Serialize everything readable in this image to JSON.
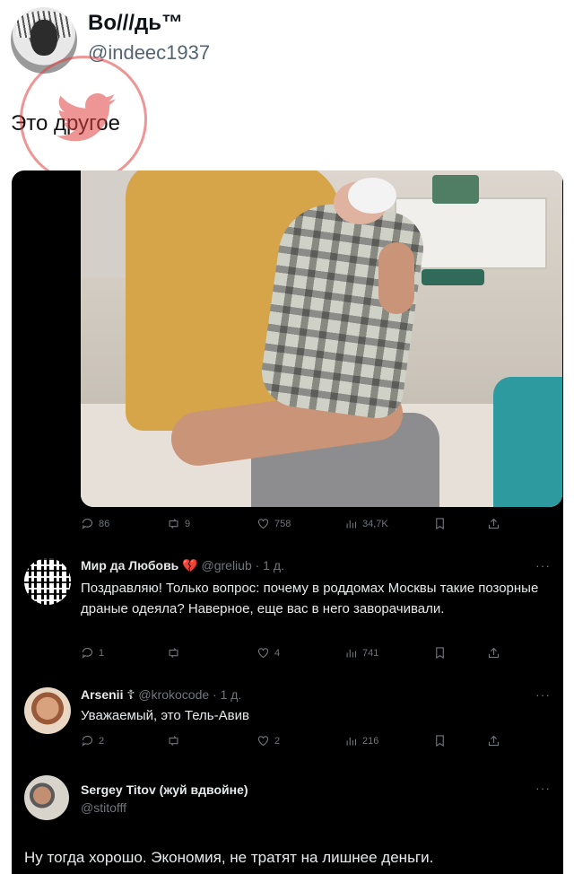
{
  "outer": {
    "name": "Во///дь™",
    "handle": "@indeec1937",
    "text": "Это другое"
  },
  "main_tweet_actions": {
    "replies": "86",
    "retweets": "9",
    "likes": "758",
    "views": "34,7K"
  },
  "replies": [
    {
      "name": "Мир да Любовь 💔",
      "handle_time": "@greliub · 1 д.",
      "text": "Поздравляю! Только вопрос: почему в роддомах Москвы такие позорные драные одеяла? Наверное, еще вас в него заворачивали.",
      "replies": "1",
      "retweets": "",
      "likes": "4",
      "views": "741"
    },
    {
      "name": "Arsenii ☦",
      "handle_time": "@krokocode · 1 д.",
      "text": "Уважаемый, это Тель-Авив",
      "replies": "2",
      "retweets": "",
      "likes": "2",
      "views": "216"
    }
  ],
  "last_post": {
    "name": "Sergey Titov (жуй вдвойне)",
    "handle": "@stitofff",
    "text": "Ну тогда хорошо. Экономия, не тратят на лишнее деньги."
  },
  "more_label": "···",
  "colors": {
    "dark_bg": "#000000",
    "muted": "#71767b",
    "watermark": "#e04040"
  }
}
